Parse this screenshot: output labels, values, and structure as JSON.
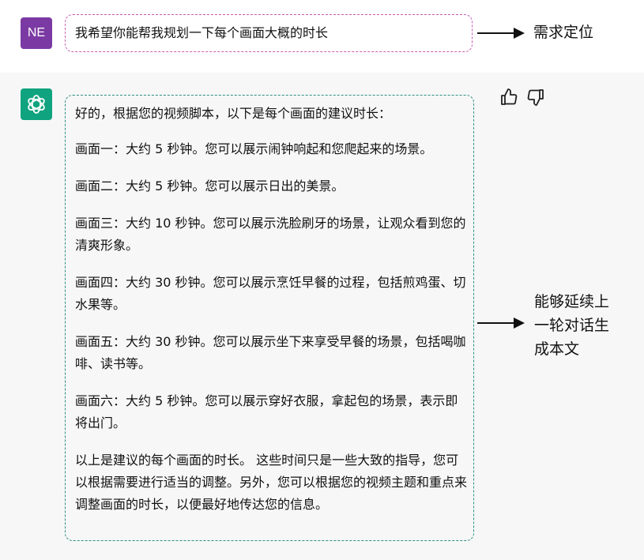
{
  "colors": {
    "user_avatar_bg": "#7b3aa3",
    "bot_avatar_bg": "#10a37f",
    "prompt_border": "#c75bb3",
    "response_border": "#2f8f7f",
    "assistant_bg": "#f7f7f8"
  },
  "user": {
    "avatar_text": "NE",
    "message": "我希望你能帮我规划一下每个画面大概的时长"
  },
  "assistant": {
    "avatar_icon": "openai-logo-icon",
    "paragraphs": [
      "好的，根据您的视频脚本，以下是每个画面的建议时长：",
      "画面一：大约 5 秒钟。您可以展示闹钟响起和您爬起来的场景。",
      "画面二：大约 5 秒钟。您可以展示日出的美景。",
      "画面三：大约 10 秒钟。您可以展示洗脸刷牙的场景，让观众看到您的清爽形象。",
      "画面四：大约 30 秒钟。您可以展示烹饪早餐的过程，包括煎鸡蛋、切水果等。",
      "画面五：大约 30 秒钟。您可以展示坐下来享受早餐的场景，包括喝咖啡、读书等。",
      "画面六：大约 5 秒钟。您可以展示穿好衣服，拿起包的场景，表示即将出门。",
      "以上是建议的每个画面的时长。 这些时间只是一些大致的指导，您可以根据需要进行适当的调整。另外，您可以根据您的视频主题和重点来调整画面的时长，以便最好地传达您的信息。"
    ],
    "feedback": {
      "thumbs_up_icon": "thumbs-up-icon",
      "thumbs_down_icon": "thumbs-down-icon"
    }
  },
  "annotations": {
    "prompt_label": "需求定位",
    "response_label": "能够延续上\n一轮对话生\n成本文"
  }
}
